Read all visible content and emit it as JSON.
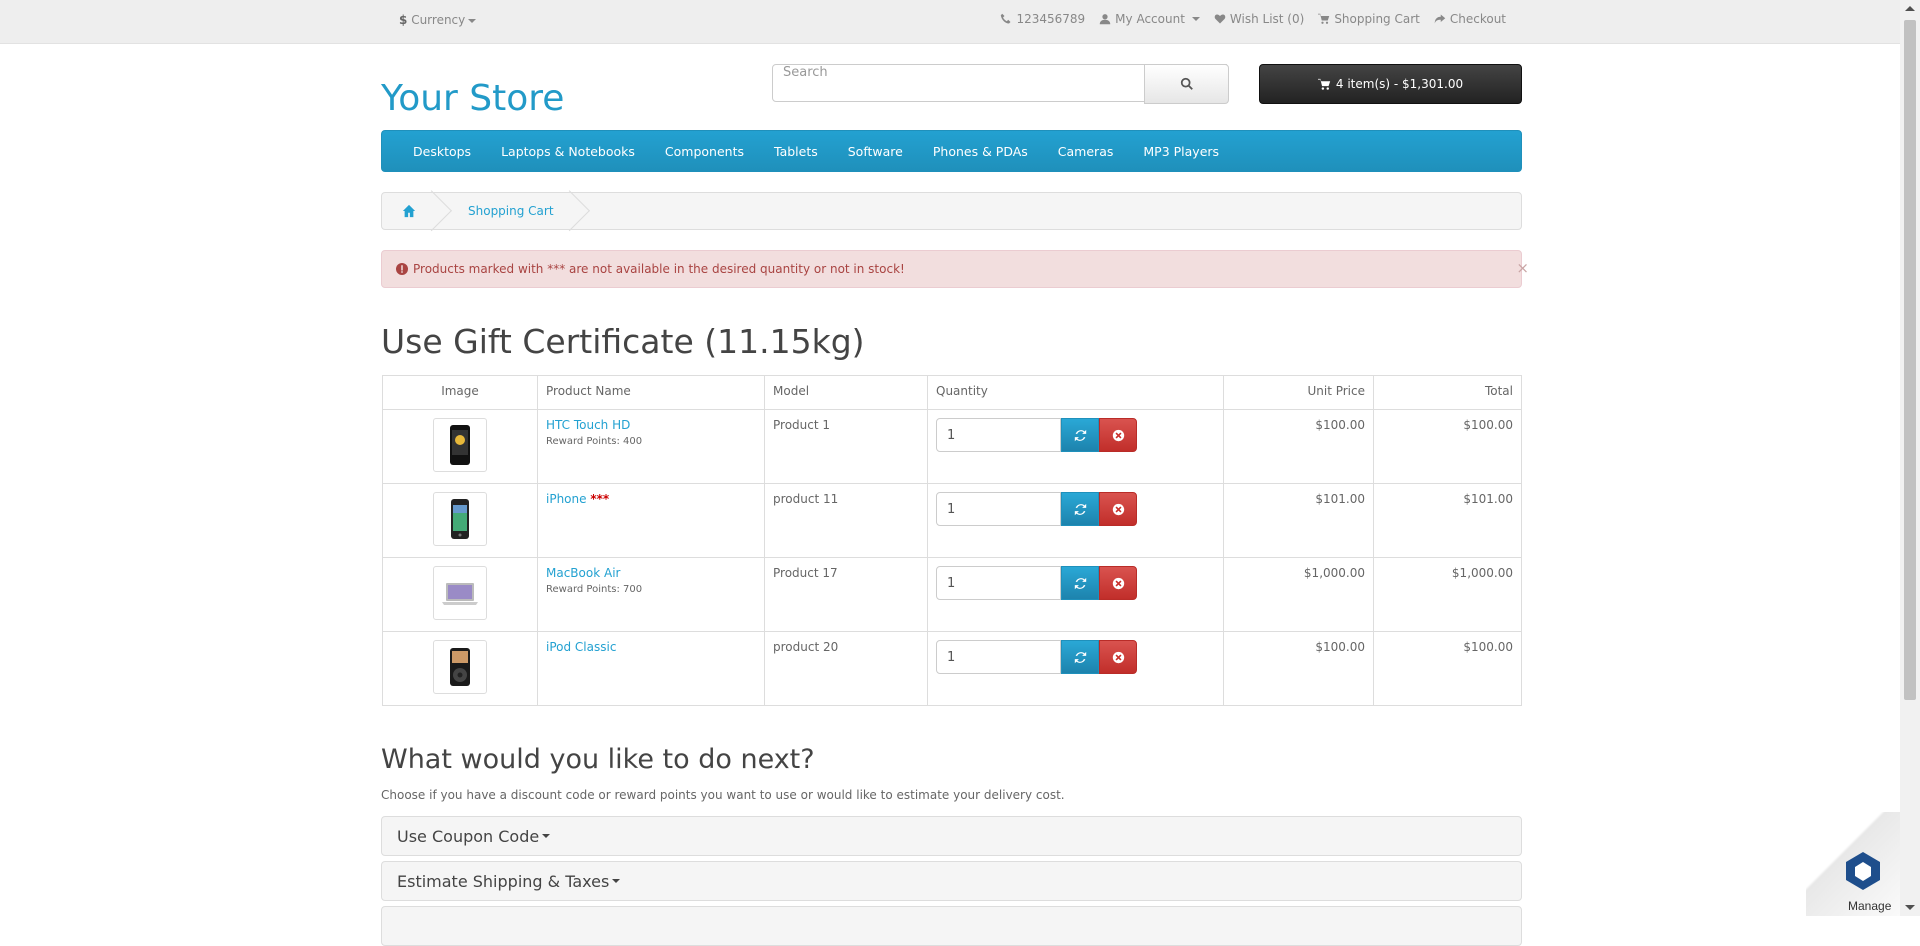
{
  "topbar": {
    "currency_symbol": "$",
    "currency_label": "Currency",
    "phone": "123456789",
    "my_account": "My Account",
    "wishlist": "Wish List (0)",
    "shopping_cart": "Shopping Cart",
    "checkout": "Checkout"
  },
  "header": {
    "logo": "Your Store",
    "search_placeholder": "Search",
    "cart_button": "4 item(s) - $1,301.00"
  },
  "menu": [
    "Desktops",
    "Laptops & Notebooks",
    "Components",
    "Tablets",
    "Software",
    "Phones & PDAs",
    "Cameras",
    "MP3 Players"
  ],
  "breadcrumb": {
    "current": "Shopping Cart"
  },
  "alert": {
    "text": "Products marked with *** are not available in the desired quantity or not in stock!",
    "close": "×"
  },
  "page_title": "Use Gift Certificate  (11.15kg)",
  "table": {
    "headers": [
      "Image",
      "Product Name",
      "Model",
      "Quantity",
      "Unit Price",
      "Total"
    ],
    "rows": [
      {
        "name": "HTC Touch HD",
        "stock_flag": "",
        "reward": "Reward Points: 400",
        "model": "Product 1",
        "qty": "1",
        "unit_price": "$100.00",
        "total": "$100.00",
        "image": "phone-black-icon"
      },
      {
        "name": "iPhone",
        "stock_flag": "***",
        "reward": "",
        "model": "product 11",
        "qty": "1",
        "unit_price": "$101.00",
        "total": "$101.00",
        "image": "iphone-icon"
      },
      {
        "name": "MacBook Air",
        "stock_flag": "",
        "reward": "Reward Points: 700",
        "model": "Product 17",
        "qty": "1",
        "unit_price": "$1,000.00",
        "total": "$1,000.00",
        "image": "laptop-icon"
      },
      {
        "name": "iPod Classic",
        "stock_flag": "",
        "reward": "",
        "model": "product 20",
        "qty": "1",
        "unit_price": "$100.00",
        "total": "$100.00",
        "image": "ipod-icon"
      }
    ]
  },
  "next": {
    "title": "What would you like to do next?",
    "description": "Choose if you have a discount code or reward points you want to use or would like to estimate your delivery cost.",
    "panels": [
      "Use Coupon Code",
      "Estimate Shipping & Taxes"
    ]
  },
  "widget": {
    "label": "Manage"
  },
  "colors": {
    "link": "#23a1d1",
    "menu": "#229ac8",
    "alert_bg": "#f2dede",
    "alert_text": "#a94442",
    "remove": "#d9534f"
  }
}
